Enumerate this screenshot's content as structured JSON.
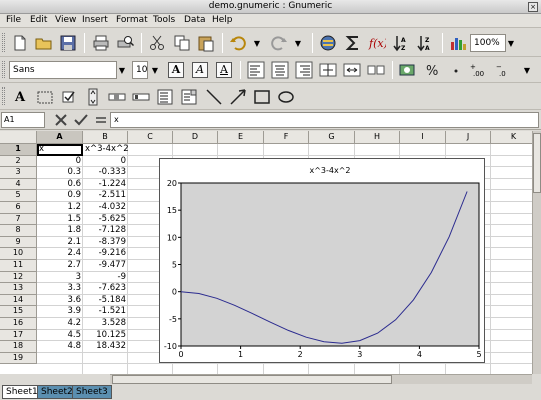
{
  "window": {
    "title": "demo.gnumeric : Gnumeric",
    "close_glyph": "×"
  },
  "menu": [
    "File",
    "Edit",
    "View",
    "Insert",
    "Format",
    "Tools",
    "Data",
    "Help"
  ],
  "toolbar": {
    "zoom": "100%",
    "font_name": "Sans",
    "font_size": "10",
    "bold_label": "A",
    "italic_label": "A",
    "underline_label": "A",
    "text_tool_label": "A"
  },
  "formula_bar": {
    "cell_ref": "A1",
    "content": "x"
  },
  "columns": [
    "A",
    "B",
    "C",
    "D",
    "E",
    "F",
    "G",
    "H",
    "I",
    "J",
    "K"
  ],
  "rows": [
    "1",
    "2",
    "3",
    "4",
    "5",
    "6",
    "7",
    "8",
    "9",
    "10",
    "11",
    "12",
    "13",
    "14",
    "15",
    "16",
    "17",
    "18",
    "19"
  ],
  "cells": {
    "header_x": "x",
    "header_y": "x^3-4x^2",
    "x": [
      "0",
      "0.3",
      "0.6",
      "0.9",
      "1.2",
      "1.5",
      "1.8",
      "2.1",
      "2.4",
      "2.7",
      "3",
      "3.3",
      "3.6",
      "3.9",
      "4.2",
      "4.5",
      "4.8"
    ],
    "y": [
      "0",
      "-0.333",
      "-1.224",
      "-2.511",
      "-4.032",
      "-5.625",
      "-7.128",
      "-8.379",
      "-9.216",
      "-9.477",
      "-9",
      "-7.623",
      "-5.184",
      "-1.521",
      "3.528",
      "10.125",
      "18.432"
    ]
  },
  "sheet_tabs": [
    "Sheet1",
    "Sheet2",
    "Sheet3"
  ],
  "chart_data": {
    "type": "line",
    "title": "x^3-4x^2",
    "x": [
      0,
      0.3,
      0.6,
      0.9,
      1.2,
      1.5,
      1.8,
      2.1,
      2.4,
      2.7,
      3,
      3.3,
      3.6,
      3.9,
      4.2,
      4.5,
      4.8
    ],
    "series": [
      {
        "values": [
          0,
          -0.333,
          -1.224,
          -2.511,
          -4.032,
          -5.625,
          -7.128,
          -8.379,
          -9.216,
          -9.477,
          -9,
          -7.623,
          -5.184,
          -1.521,
          3.528,
          10.125,
          18.432
        ]
      }
    ],
    "xlim": [
      0,
      5
    ],
    "ylim": [
      -10,
      20
    ],
    "xticks": [
      "0",
      "1",
      "2",
      "3",
      "4",
      "5"
    ],
    "yticks": [
      "20",
      "15",
      "10",
      "5",
      "0",
      "-5",
      "-10"
    ],
    "line_color": "#2b2b8f",
    "plot_bg": "#d3d3d3",
    "grid": false
  }
}
